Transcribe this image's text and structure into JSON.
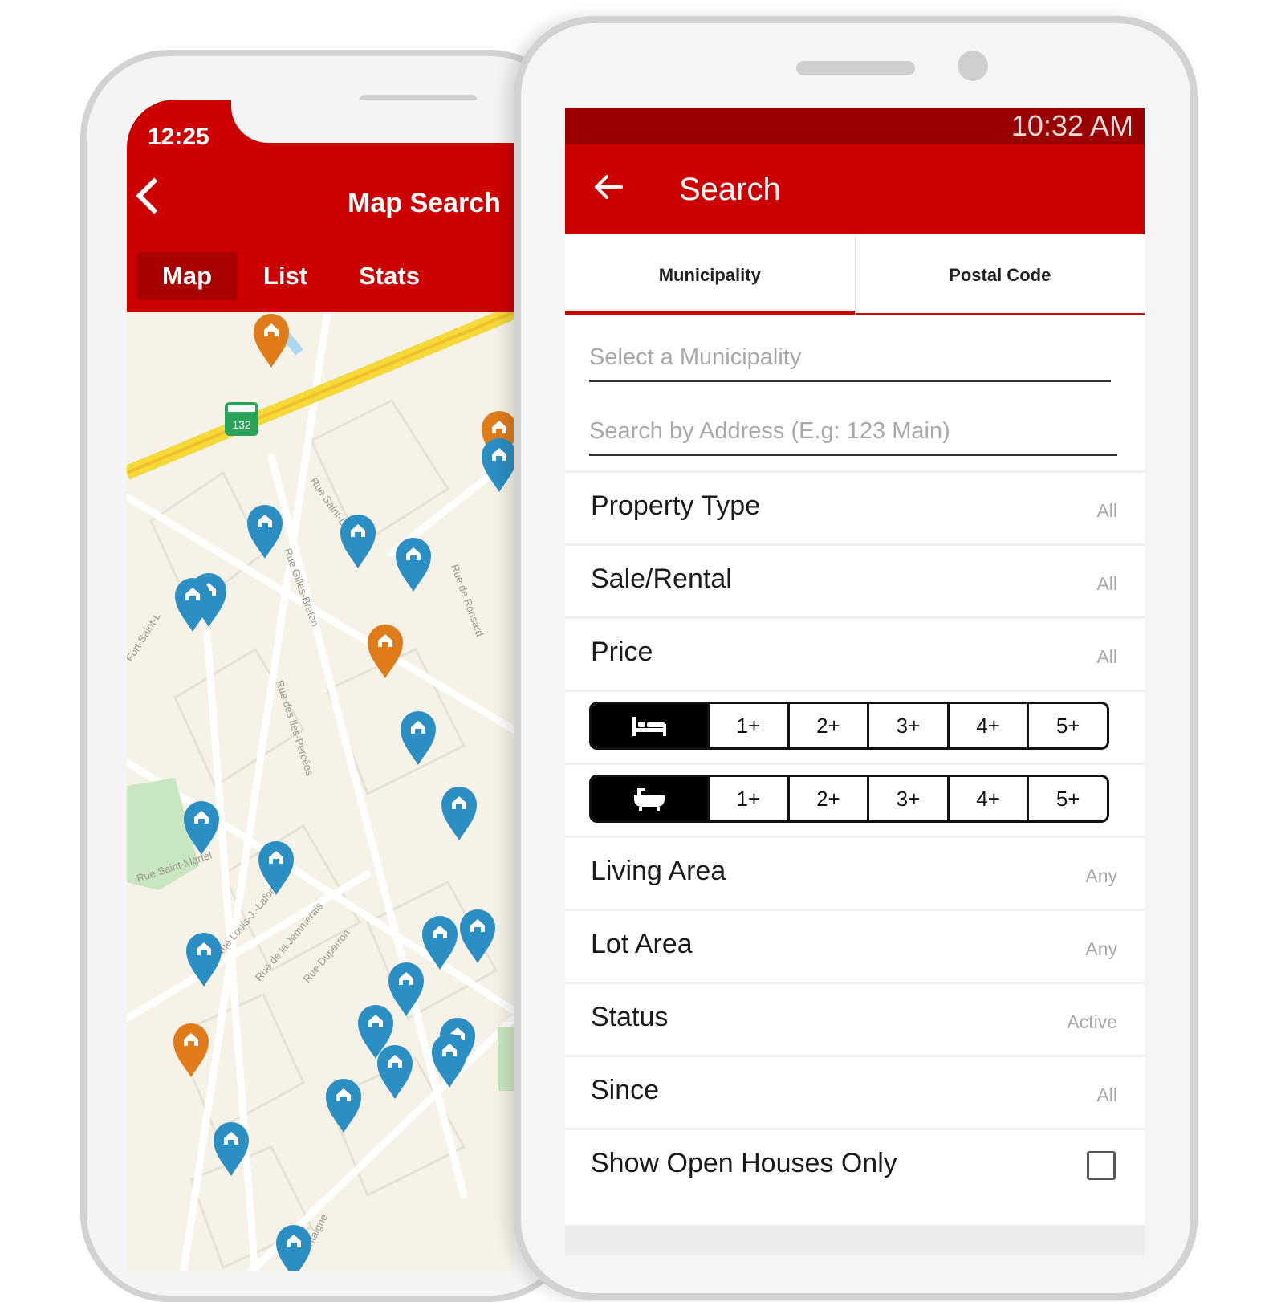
{
  "map_screen": {
    "status_time": "12:25",
    "title": "Map Search",
    "tabs": [
      {
        "label": "Map",
        "active": true
      },
      {
        "label": "List",
        "active": false
      },
      {
        "label": "Stats",
        "active": false
      }
    ],
    "highway_shield": "132",
    "street_labels": [
      "Rue Saint-Laurent",
      "Rue Gilles-Breton",
      "Rue de Ronsard",
      "Fort-Saint-L",
      "Rue des Iles-Percées",
      "Rue Saint-Martel",
      "Rue Louis-J.-Lafortune",
      "Rue de la Jemmerais",
      "Rue Duperron",
      "Montaigne"
    ],
    "marker_colors": {
      "listing": "#2b8fc3",
      "open_house": "#e07b1a"
    }
  },
  "search_screen": {
    "status_time": "10:32 AM",
    "title": "Search",
    "tabs": [
      {
        "label": "Municipality",
        "active": true
      },
      {
        "label": "Postal Code",
        "active": false
      }
    ],
    "municipality_placeholder": "Select a Municipality",
    "address_placeholder": "Search by Address (E.g: 123 Main)",
    "filters_top": [
      {
        "label": "Property Type",
        "value": "All"
      },
      {
        "label": "Sale/Rental",
        "value": "All"
      },
      {
        "label": "Price",
        "value": "All"
      }
    ],
    "bedrooms": {
      "icon": "bed-icon",
      "options": [
        "1+",
        "2+",
        "3+",
        "4+",
        "5+"
      ]
    },
    "bathrooms": {
      "icon": "bathtub-icon",
      "options": [
        "1+",
        "2+",
        "3+",
        "4+",
        "5+"
      ]
    },
    "filters_bottom": [
      {
        "label": "Living Area",
        "value": "Any"
      },
      {
        "label": "Lot Area",
        "value": "Any"
      },
      {
        "label": "Status",
        "value": "Active"
      },
      {
        "label": "Since",
        "value": "All"
      }
    ],
    "open_houses_label": "Show Open Houses Only",
    "open_houses_checked": false
  },
  "colors": {
    "brand_red": "#cc0000",
    "status_bar_red": "#990000"
  }
}
